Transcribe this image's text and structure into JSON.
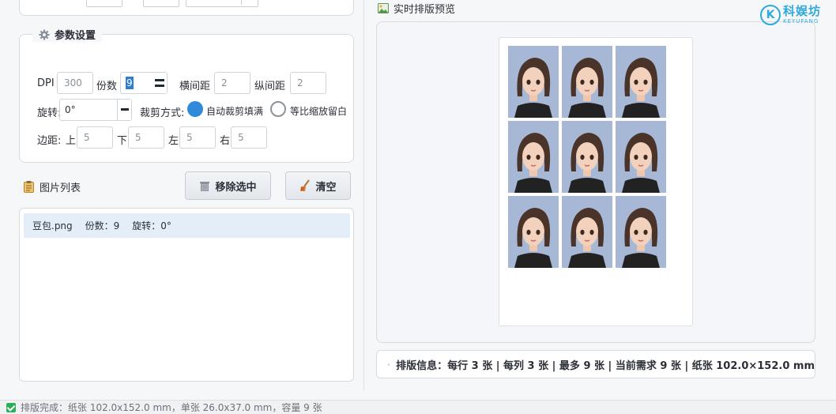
{
  "params": {
    "title": "参数设置",
    "dpi_label": "DPI",
    "dpi_value": "300",
    "copies_label": "份数",
    "copies_value": "9",
    "hgap_label": "横间距",
    "hgap_value": "2",
    "vgap_label": "纵间距",
    "vgap_value": "2",
    "rotation_label": "旋转:",
    "rotation_value": "0°",
    "crop_label": "裁剪方式:",
    "crop_auto_label": "自动裁剪填满",
    "crop_scale_label": "等比缩放留白",
    "margin_label": "边距:",
    "margin_top_label": "上",
    "margin_top_value": "5",
    "margin_bottom_label": "下",
    "margin_bottom_value": "5",
    "margin_left_label": "左",
    "margin_left_value": "5",
    "margin_right_label": "右",
    "margin_right_value": "5"
  },
  "list": {
    "title": "图片列表",
    "remove_label": "移除选中",
    "clear_label": "清空",
    "items": [
      {
        "name": "豆包.png",
        "copies": "份数：9",
        "rotation": "旋转：0°"
      }
    ]
  },
  "preview": {
    "title": "实时排版预览",
    "rows": 3,
    "cols": 3
  },
  "info": {
    "text": "排版信息：每行 3 张 | 每列 3 张 | 最多 9 张 | 当前需求 9 张 | 纸张 102.0×152.0 mm"
  },
  "logo": {
    "cn": "科娱坊",
    "en": "KEYUFANG",
    "mark": "K"
  },
  "status": {
    "text": "排版完成：纸张 102.0x152.0 mm，单张 26.0x37.0 mm，容量 9 张"
  },
  "colors": {
    "accent": "#2f8ad9",
    "photo_bg": "#a6b8d6",
    "status_ok": "#2fae5a",
    "logo": "#2ea9dd"
  },
  "icons": {
    "params": "gear-icon",
    "list": "clipboard-icon",
    "remove": "trash-icon",
    "clear": "broom-icon",
    "preview": "image-icon",
    "info": "bar-chart-icon",
    "status": "checkmark-icon"
  }
}
